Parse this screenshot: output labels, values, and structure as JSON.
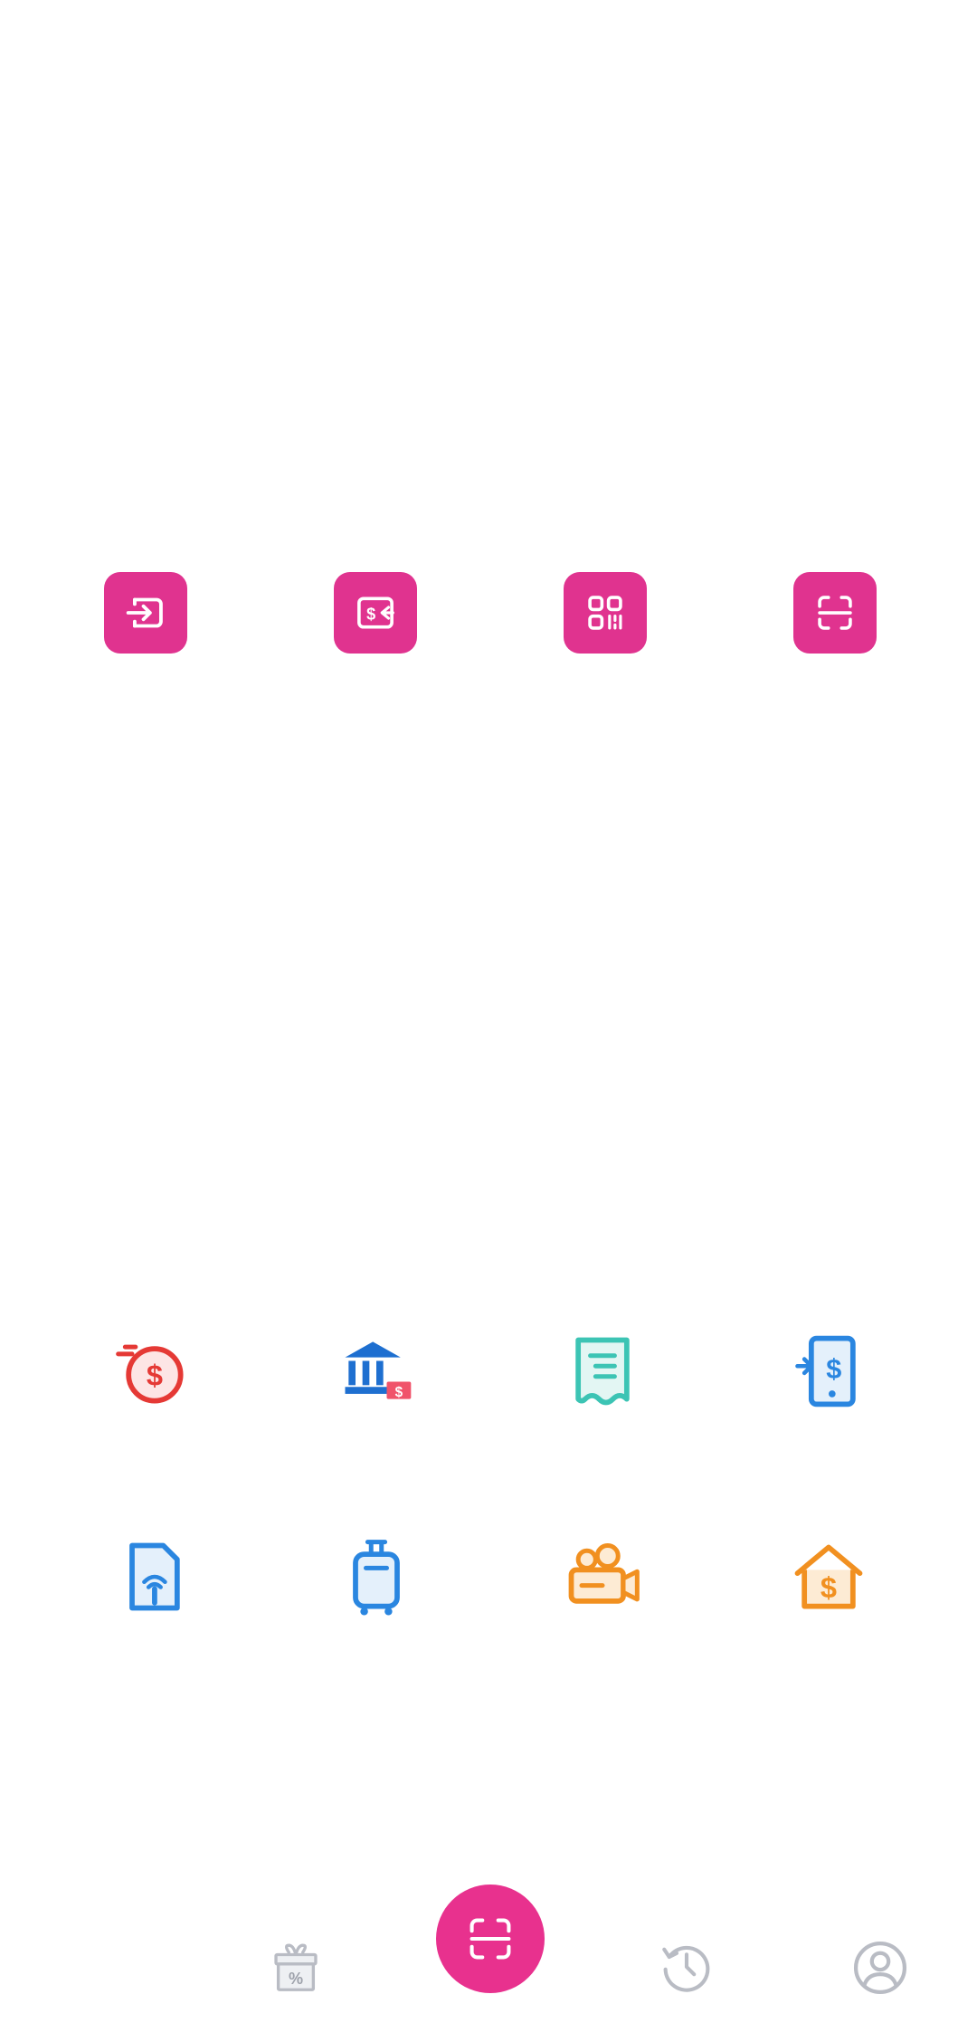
{
  "quick_actions": [
    {
      "name": "login-icon"
    },
    {
      "name": "transfer-money-icon"
    },
    {
      "name": "qr-code-icon"
    },
    {
      "name": "scan-icon"
    }
  ],
  "services": [
    {
      "name": "dollar-refund-icon",
      "color": "#e53935"
    },
    {
      "name": "bank-icon",
      "color": "#1e6fd0"
    },
    {
      "name": "receipt-icon",
      "color": "#3cc4b4"
    },
    {
      "name": "mobile-payment-icon",
      "color": "#2a86e0"
    },
    {
      "name": "sim-card-icon",
      "color": "#2a86e0"
    },
    {
      "name": "luggage-icon",
      "color": "#2a86e0"
    },
    {
      "name": "movie-camera-icon",
      "color": "#f19020"
    },
    {
      "name": "house-dollar-icon",
      "color": "#f19020"
    }
  ],
  "bottom_nav": [
    {
      "name": "gift-discount-icon"
    },
    {
      "name": "scan-icon"
    },
    {
      "name": "history-icon"
    },
    {
      "name": "profile-icon"
    }
  ],
  "colors": {
    "primary": "#e0338f",
    "nav_grey": "#b9bcc4"
  }
}
